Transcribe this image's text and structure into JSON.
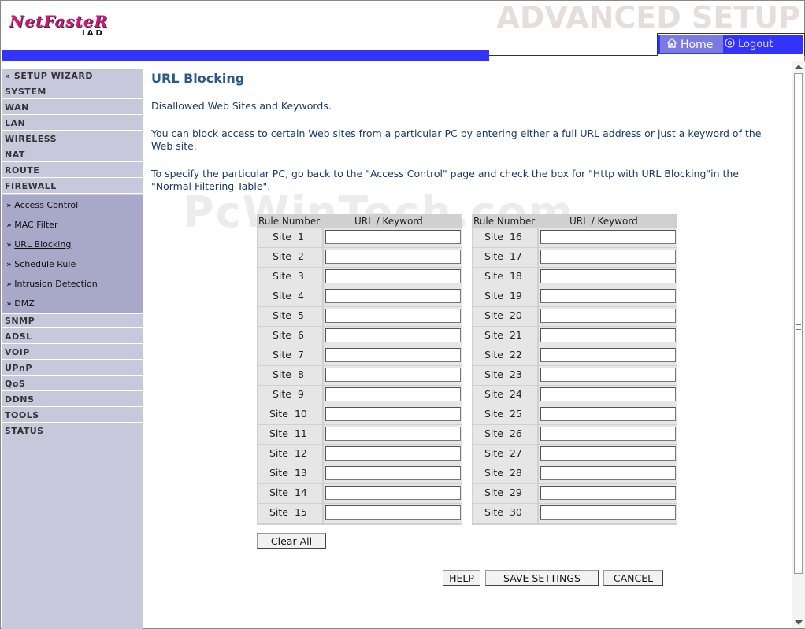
{
  "header": {
    "logo_main": "NetFasteR",
    "logo_sub": "IAD",
    "title": "ADVANCED SETUP",
    "home_label": "Home",
    "logout_label": "Logout"
  },
  "sidebar": {
    "wizard": "» SETUP WIZARD",
    "items_top": [
      "SYSTEM",
      "WAN",
      "LAN",
      "WIRELESS",
      "NAT",
      "ROUTE",
      "FIREWALL"
    ],
    "firewall_sub": [
      "Access Control",
      "MAC Filter",
      "URL Blocking",
      "Schedule Rule",
      "Intrusion Detection",
      "DMZ"
    ],
    "active_sub": "URL Blocking",
    "items_bottom": [
      "SNMP",
      "ADSL",
      "VOIP",
      "UPnP",
      "QoS",
      "DDNS",
      "TOOLS",
      "STATUS"
    ]
  },
  "main": {
    "title": "URL Blocking",
    "intro": "Disallowed Web Sites and Keywords.",
    "para1": "You can block access to certain Web sites from a particular PC by entering either a full URL address or just a keyword of the Web site.",
    "para2": "To specify the particular PC, go back to the \"Access Control\" page and check the box for \"Http with URL Blocking\"in the \"Normal Filtering Table\".",
    "watermark": "PcWinTech.com",
    "col_rule": "Rule Number",
    "col_url": "URL / Keyword",
    "site_prefix": "Site",
    "left_sites": [
      1,
      2,
      3,
      4,
      5,
      6,
      7,
      8,
      9,
      10,
      11,
      12,
      13,
      14,
      15
    ],
    "right_sites": [
      16,
      17,
      18,
      19,
      20,
      21,
      22,
      23,
      24,
      25,
      26,
      27,
      28,
      29,
      30
    ],
    "clear_all": "Clear All",
    "help": "HELP",
    "save": "SAVE SETTINGS",
    "cancel": "CANCEL"
  },
  "colors": {
    "accent_blue": "#3333ff",
    "sidebar_bg": "#c8c8dc",
    "title_color": "#2a5a8a",
    "logo_pink": "#d4147a"
  }
}
